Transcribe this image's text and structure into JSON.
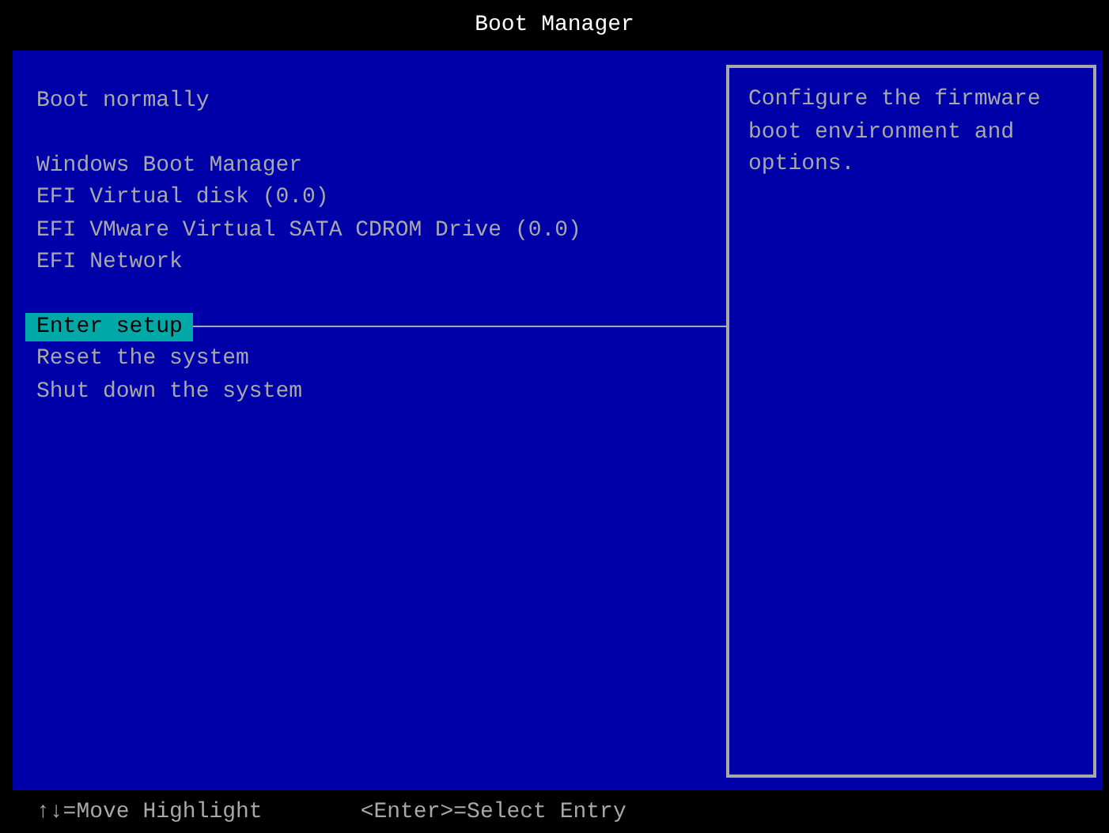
{
  "title": "Boot Manager",
  "menu_groups": [
    {
      "items": [
        {
          "label": "Boot normally",
          "selected": false
        }
      ]
    },
    {
      "items": [
        {
          "label": "Windows Boot Manager",
          "selected": false
        },
        {
          "label": "EFI Virtual disk (0.0)",
          "selected": false
        },
        {
          "label": "EFI VMware Virtual SATA CDROM Drive (0.0)",
          "selected": false
        },
        {
          "label": "EFI Network",
          "selected": false
        }
      ]
    },
    {
      "items": [
        {
          "label": "Enter setup",
          "selected": true
        },
        {
          "label": "Reset the system",
          "selected": false
        },
        {
          "label": "Shut down the system",
          "selected": false
        }
      ]
    }
  ],
  "help_text": "Configure the firmware boot environment and options.",
  "status_bar": [
    "↑↓=Move Highlight",
    "<Enter>=Select Entry"
  ]
}
